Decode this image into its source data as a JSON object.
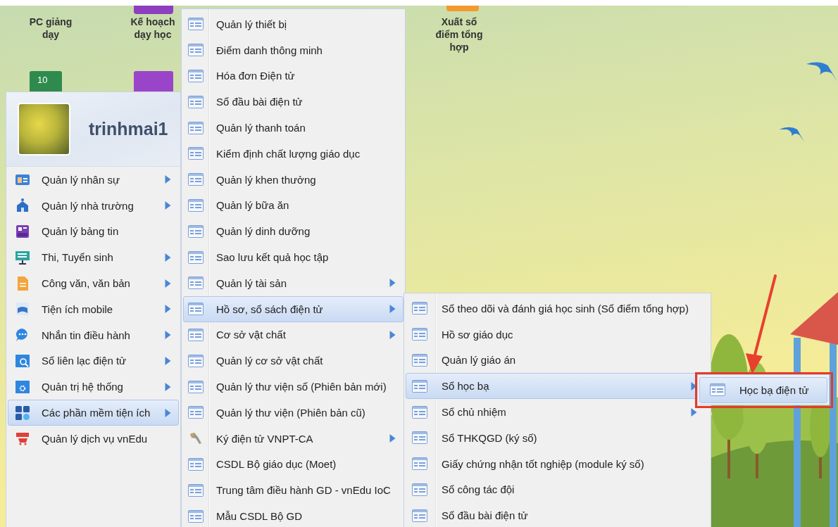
{
  "gradebook_icon_text": "10",
  "desktop_icons": [
    {
      "label": "PC giảng dạy"
    },
    {
      "label": "Kế hoạch dạy học"
    },
    {
      "label": "Xuất sổ điểm tổng hợp"
    }
  ],
  "start_menu": {
    "username": "trinhmai1",
    "items": [
      {
        "label": "Quản lý nhân sự",
        "has_submenu": true,
        "selected": false
      },
      {
        "label": "Quản lý nhà trường",
        "has_submenu": true,
        "selected": false
      },
      {
        "label": "Quản lý bảng tin",
        "has_submenu": false,
        "selected": false
      },
      {
        "label": "Thi, Tuyển sinh",
        "has_submenu": true,
        "selected": false
      },
      {
        "label": "Công văn, văn bản",
        "has_submenu": true,
        "selected": false
      },
      {
        "label": "Tiện ích mobile",
        "has_submenu": true,
        "selected": false
      },
      {
        "label": "Nhắn tin điều hành",
        "has_submenu": true,
        "selected": false
      },
      {
        "label": "Sổ liên lạc điện tử",
        "has_submenu": true,
        "selected": false
      },
      {
        "label": "Quản trị hệ thống",
        "has_submenu": true,
        "selected": false
      },
      {
        "label": "Các phần mềm tiện ích",
        "has_submenu": true,
        "selected": true
      },
      {
        "label": "Quản lý dịch vụ vnEdu",
        "has_submenu": false,
        "selected": false
      }
    ]
  },
  "submenu_1": {
    "items": [
      {
        "label": "Quản lý thiết bị",
        "has_submenu": false,
        "selected": false
      },
      {
        "label": "Điểm danh thông minh",
        "has_submenu": false,
        "selected": false
      },
      {
        "label": "Hóa đơn Điện tử",
        "has_submenu": false,
        "selected": false
      },
      {
        "label": "Sổ đầu bài điện tử",
        "has_submenu": false,
        "selected": false
      },
      {
        "label": "Quản lý thanh toán",
        "has_submenu": false,
        "selected": false
      },
      {
        "label": "Kiểm định chất lượng giáo dục",
        "has_submenu": false,
        "selected": false
      },
      {
        "label": "Quản lý khen thưởng",
        "has_submenu": false,
        "selected": false
      },
      {
        "label": "Quản lý bữa ăn",
        "has_submenu": false,
        "selected": false
      },
      {
        "label": "Quản lý dinh dưỡng",
        "has_submenu": false,
        "selected": false
      },
      {
        "label": "Sao lưu kết quả học tập",
        "has_submenu": false,
        "selected": false
      },
      {
        "label": "Quản lý tài sản",
        "has_submenu": true,
        "selected": false
      },
      {
        "label": "Hồ sơ, sổ sách điện tử",
        "has_submenu": true,
        "selected": true
      },
      {
        "label": "Cơ sở vật chất",
        "has_submenu": true,
        "selected": false
      },
      {
        "label": "Quản lý cơ sở vật chất",
        "has_submenu": false,
        "selected": false
      },
      {
        "label": "Quản lý thư viện số (Phiên bản mới)",
        "has_submenu": false,
        "selected": false
      },
      {
        "label": "Quản lý thư viện (Phiên bản cũ)",
        "has_submenu": false,
        "selected": false
      },
      {
        "label": "Ký điện tử VNPT-CA",
        "has_submenu": true,
        "selected": false
      },
      {
        "label": "CSDL Bộ giáo dục (Moet)",
        "has_submenu": false,
        "selected": false
      },
      {
        "label": "Trung tâm điều hành GD - vnEdu IoC",
        "has_submenu": false,
        "selected": false
      },
      {
        "label": "Mẫu CSDL Bộ GD",
        "has_submenu": false,
        "selected": false
      }
    ]
  },
  "submenu_2": {
    "items": [
      {
        "label": "Sổ theo dõi và đánh giá học sinh (Sổ điểm tổng hợp)",
        "has_submenu": false,
        "selected": false
      },
      {
        "label": "Hồ sơ giáo dục",
        "has_submenu": false,
        "selected": false
      },
      {
        "label": "Quản lý giáo án",
        "has_submenu": false,
        "selected": false
      },
      {
        "label": "Sổ học bạ",
        "has_submenu": true,
        "selected": true
      },
      {
        "label": "Sổ chủ nhiệm",
        "has_submenu": true,
        "selected": false
      },
      {
        "label": "Sổ THKQGD (ký số)",
        "has_submenu": false,
        "selected": false
      },
      {
        "label": "Giấy chứng nhận tốt nghiệp (module ký số)",
        "has_submenu": false,
        "selected": false
      },
      {
        "label": "Sổ công tác đội",
        "has_submenu": false,
        "selected": false
      },
      {
        "label": "Sổ đầu bài điện tử",
        "has_submenu": false,
        "selected": false
      }
    ]
  },
  "submenu_3": {
    "items": [
      {
        "label": "Học bạ điện tử",
        "has_submenu": false,
        "selected": true
      }
    ]
  }
}
